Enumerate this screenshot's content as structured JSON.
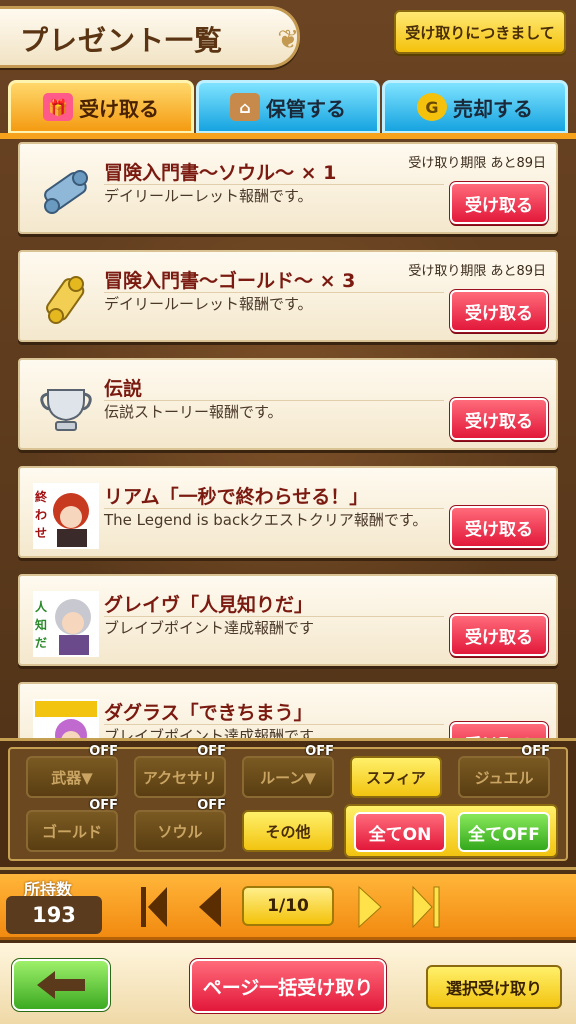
{
  "header": {
    "title": "プレゼント一覧",
    "notice_button": "受け取りにつきまして"
  },
  "tabs": [
    {
      "label": "受け取る",
      "icon": "gift-icon",
      "active": true
    },
    {
      "label": "保管する",
      "icon": "house-icon",
      "active": false
    },
    {
      "label": "売却する",
      "icon": "coin-icon",
      "active": false
    }
  ],
  "items": [
    {
      "title": "冒険入門書〜ソウル〜 × 1",
      "desc": "デイリールーレット報酬です。",
      "deadline": "受け取り期限 あと89日",
      "button": "受け取る",
      "icon": "blue-scroll-icon"
    },
    {
      "title": "冒険入門書〜ゴールド〜 × 3",
      "desc": "デイリールーレット報酬です。",
      "deadline": "受け取り期限 あと89日",
      "button": "受け取る",
      "icon": "gold-scroll-icon"
    },
    {
      "title": "伝説",
      "desc": "伝説ストーリー報酬です。",
      "deadline": "",
      "button": "受け取る",
      "icon": "silver-cup-icon"
    },
    {
      "title": "リアム「一秒で終わらせる！」",
      "desc": "The Legend is backクエストクリア報酬です。",
      "deadline": "",
      "button": "受け取る",
      "icon": "liam-stamp-icon"
    },
    {
      "title": "グレイヴ「人見知りだ」",
      "desc": "ブレイブポイント達成報酬です",
      "deadline": "",
      "button": "受け取る",
      "icon": "grave-stamp-icon"
    },
    {
      "title": "ダグラス「できちまう」",
      "desc": "ブレイブポイント達成報酬です",
      "deadline": "",
      "button": "受け取る",
      "icon": "douglas-stamp-icon"
    }
  ],
  "filters": {
    "off_tag": "OFF",
    "row1": [
      {
        "label": "武器▼",
        "state": "off"
      },
      {
        "label": "アクセサリ",
        "state": "off"
      },
      {
        "label": "ルーン▼",
        "state": "off"
      },
      {
        "label": "スフィア",
        "state": "on"
      },
      {
        "label": "ジュエル",
        "state": "off"
      }
    ],
    "row2": [
      {
        "label": "ゴールド",
        "state": "off"
      },
      {
        "label": "ソウル",
        "state": "off"
      },
      {
        "label": "その他",
        "state": "on"
      }
    ],
    "all_on": "全てON",
    "all_off": "全てOFF"
  },
  "pager": {
    "owned_label": "所持数",
    "owned_count": "193",
    "page": "1/10"
  },
  "bottom": {
    "bulk_receive": "ページ一括受け取り",
    "select_receive": "選択受け取り"
  },
  "colors": {
    "accent_red": "#e2183a",
    "tab_orange": "#f49b12",
    "tab_blue": "#16a3e0"
  }
}
